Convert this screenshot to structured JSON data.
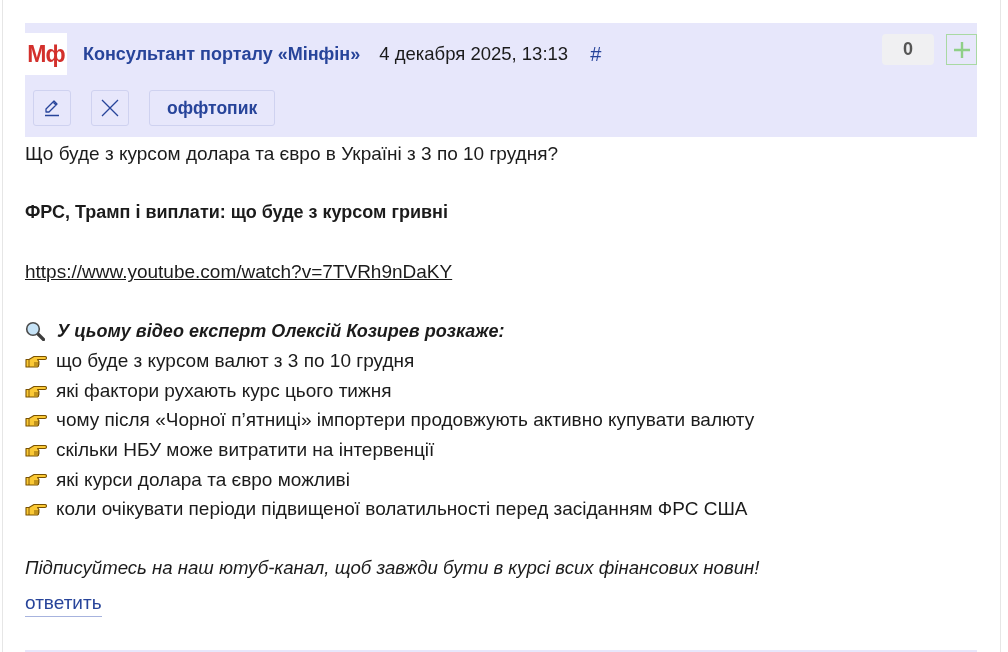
{
  "comment": {
    "avatar": {
      "text": "Мф"
    },
    "author": "Консультант порталу «Мінфін»",
    "date": "4 декабря 2025, 13:13",
    "anchor": "#",
    "rating": {
      "count": "0"
    },
    "actions": [
      {
        "kind": "edit"
      },
      {
        "kind": "delete"
      },
      {
        "kind": "tag",
        "label": "оффтопик"
      }
    ],
    "body": [
      {
        "kind": "text",
        "text": "Що буде з курсом долара та євро в Україні з 3 по 10 грудня?"
      },
      {
        "kind": "bold",
        "text": "ФРС, Трамп і виплати: що буде з курсом гривні"
      },
      {
        "kind": "link",
        "text": "https://www.youtube.com/watch?v=7TVRh9nDaKY"
      },
      {
        "kind": "list",
        "title": "У цьому відео експерт Олексій Козирев розкаже:",
        "items": [
          "що буде з курсом валют з 3 по 10 грудня",
          "які фактори рухають курс цього тижня",
          "чому після «Чорної п’ятниці» імпортери продовжують активно купувати валюту",
          "скільки НБУ може витратити на інтервенції",
          "які курси долара та євро можливі",
          "коли очікувати періоди підвищеної волатильності перед засіданням ФРС США"
        ]
      },
      {
        "kind": "italic",
        "text": "Підписуйтесь на наш ютуб-канал, щоб завжди бути в курсі всих фінансових новин!"
      }
    ],
    "reply": "ответить"
  }
}
